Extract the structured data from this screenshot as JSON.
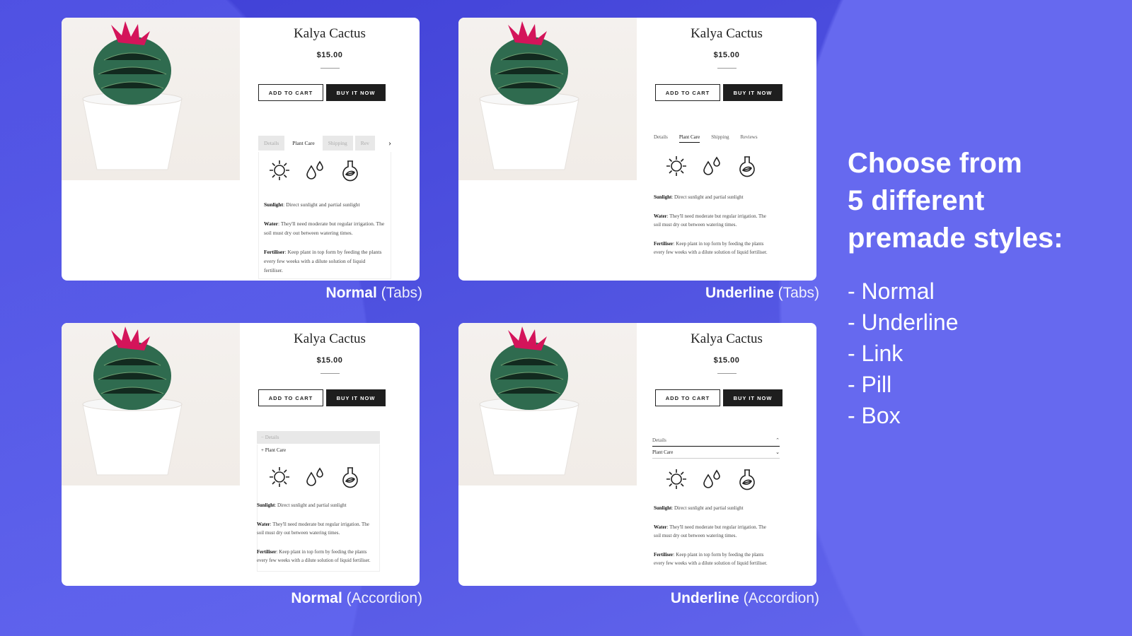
{
  "product": {
    "title": "Kalya Cactus",
    "price": "$15.00",
    "add_to_cart": "ADD TO CART",
    "buy_now": "BUY IT NOW"
  },
  "tabs": {
    "normal": [
      "Details",
      "Plant Care",
      "Shipping",
      "Rev"
    ],
    "underline": [
      "Details",
      "Plant Care",
      "Shipping",
      "Reviews"
    ],
    "active": "Plant Care"
  },
  "accordion": {
    "items": [
      "Details",
      "Plant Care"
    ]
  },
  "care": [
    {
      "label": "Sunlight",
      "text": ": Direct sunlight and partial sunlight"
    },
    {
      "label": "Water",
      "text": ": They'll need moderate but regular irrigation. The soil must dry out between watering times."
    },
    {
      "label": "Fertiliser",
      "text": ": Keep plant in top form by feeding the plants every few weeks with a dilute solution of liquid fertiliser."
    }
  ],
  "icons": [
    "sun-icon",
    "water-drops-icon",
    "flask-leaf-icon"
  ],
  "cards": [
    {
      "style": "Normal",
      "kind": "(Tabs)"
    },
    {
      "style": "Underline",
      "kind": " (Tabs)"
    },
    {
      "style": "Normal",
      "kind": "(Accordion)"
    },
    {
      "style": "Underline",
      "kind": "(Accordion)"
    }
  ],
  "headline": [
    "Choose from",
    "5 different",
    "premade styles:"
  ],
  "styles_list": [
    "- Normal",
    "- Underline",
    "- Link",
    "- Pill",
    "- Box"
  ],
  "colors": {
    "background": "#4f52e0",
    "button_dark": "#1e1e1e",
    "flower": "#d4145a",
    "cactus": "#2f6b4f"
  }
}
